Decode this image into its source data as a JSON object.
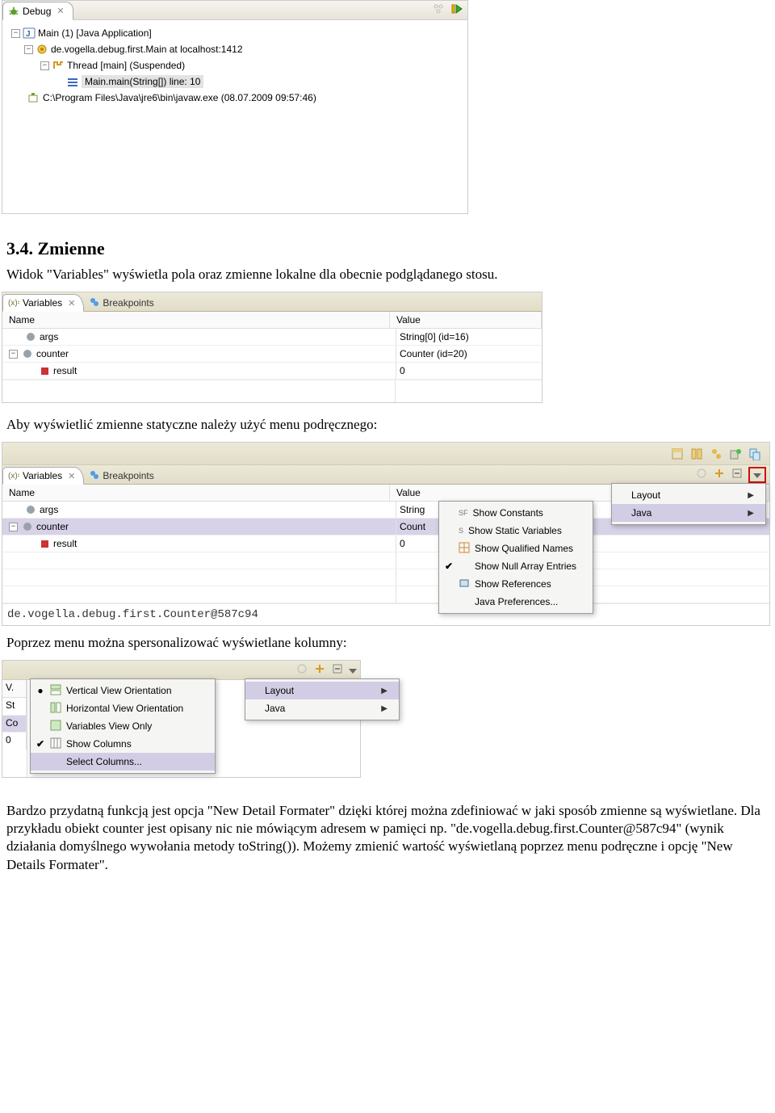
{
  "debug": {
    "tab_label": "Debug",
    "tree": {
      "app": "Main (1) [Java Application]",
      "main": "de.vogella.debug.first.Main at localhost:1412",
      "thread": "Thread [main] (Suspended)",
      "frame": "Main.main(String[]) line: 10",
      "jre": "C:\\Program Files\\Java\\jre6\\bin\\javaw.exe (08.07.2009 09:57:46)"
    }
  },
  "section": {
    "heading": "3.4. Zmienne",
    "intro": "Widok \"Variables\" wyświetla pola oraz zmienne lokalne dla obecnie podglądanego stosu."
  },
  "vars1": {
    "tab_variables": "Variables",
    "tab_breakpoints": "Breakpoints",
    "col_name": "Name",
    "col_value": "Value",
    "rows": [
      {
        "name": "args",
        "value": "String[0] (id=16)"
      },
      {
        "name": "counter",
        "value": "Counter (id=20)"
      },
      {
        "name": "result",
        "value": "0"
      }
    ]
  },
  "text_static_menu": "Aby wyświetlić zmienne statyczne należy użyć menu podręcznego:",
  "vars2": {
    "tab_variables": "Variables",
    "tab_breakpoints": "Breakpoints",
    "col_name": "Name",
    "col_value": "Value",
    "rows": [
      {
        "name": "args",
        "value": "String"
      },
      {
        "name": "counter",
        "value": "Count"
      },
      {
        "name": "result",
        "value": "0"
      }
    ],
    "menu_right": {
      "layout": "Layout",
      "java": "Java"
    },
    "submenu": {
      "show_constants": "Show Constants",
      "show_static": "Show Static Variables",
      "show_qualified": "Show Qualified Names",
      "show_null_arr": "Show Null Array Entries",
      "show_refs": "Show References",
      "java_prefs": "Java Preferences..."
    },
    "footer": "de.vogella.debug.first.Counter@587c94"
  },
  "text_columns": "Poprzez menu można spersonalizować wyświetlane kolumny:",
  "vars3": {
    "left_col_stub": [
      "V.",
      "St",
      "Co",
      "0"
    ],
    "layout_menu": {
      "vertical": "Vertical View Orientation",
      "horizontal": "Horizontal View Orientation",
      "vars_only": "Variables View Only",
      "show_cols": "Show Columns",
      "select_cols": "Select Columns..."
    },
    "right_menu": {
      "layout": "Layout",
      "java": "Java"
    }
  },
  "final_para": "Bardzo przydatną funkcją jest opcja \"New Detail Formater\" dzięki której można zdefiniować w jaki sposób zmienne są wyświetlane. Dla przykładu obiekt counter jest opisany nic nie mówiącym adresem w pamięci np. \"de.vogella.debug.first.Counter@587c94\" (wynik działania domyślnego wywołania metody toString()). Możemy zmienić wartość wyświetlaną poprzez menu podręczne i opcję \"New Details Formater\"."
}
